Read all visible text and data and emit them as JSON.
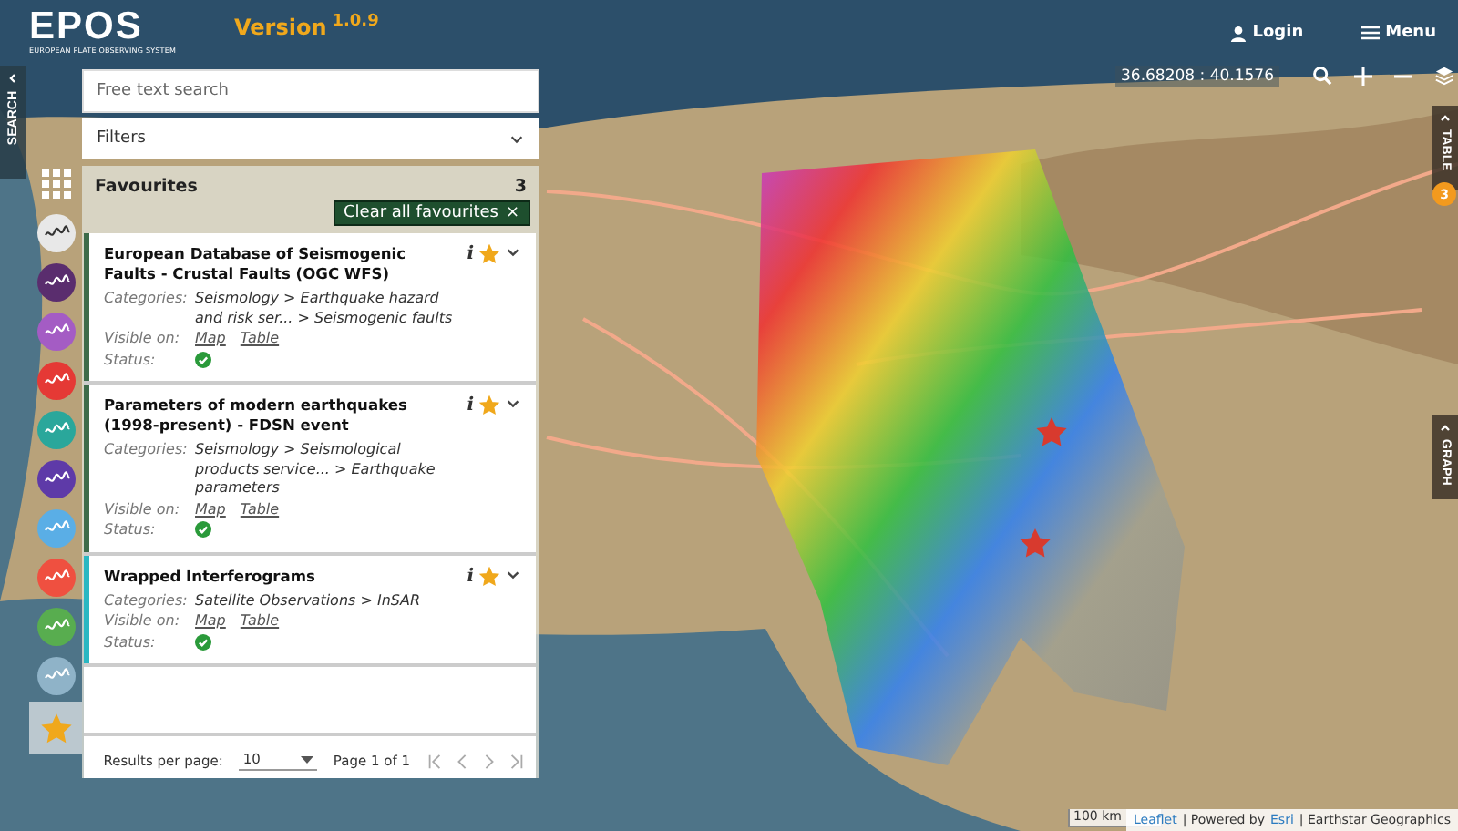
{
  "header": {
    "logo": "EPOS",
    "logo_subtitle": "EUROPEAN PLATE OBSERVING SYSTEM",
    "version_label": "Version",
    "version_number": "1.0.9",
    "login": "Login",
    "menu": "Menu"
  },
  "left_tab": {
    "label": "SEARCH"
  },
  "search": {
    "placeholder": "Free text search"
  },
  "filters": {
    "label": "Filters",
    "expanded": false
  },
  "categories": [
    {
      "kind": "grid",
      "selected": false
    },
    {
      "kind": "circle",
      "color": "#e8e8e8",
      "selected": false
    },
    {
      "kind": "circle",
      "color": "#5a2d6e",
      "selected": false
    },
    {
      "kind": "circle",
      "color": "#a45cc4",
      "selected": false
    },
    {
      "kind": "circle",
      "color": "#e53935",
      "selected": false
    },
    {
      "kind": "circle",
      "color": "#2aa79b",
      "selected": false
    },
    {
      "kind": "circle",
      "color": "#5e3aa8",
      "selected": false
    },
    {
      "kind": "circle",
      "color": "#5aaee6",
      "selected": false
    },
    {
      "kind": "circle",
      "color": "#ef5040",
      "selected": false
    },
    {
      "kind": "circle",
      "color": "#58ad4f",
      "selected": false
    },
    {
      "kind": "circle",
      "color": "#8fb3c8",
      "selected": false
    },
    {
      "kind": "star",
      "selected": true
    }
  ],
  "favourites": {
    "title": "Favourites",
    "count": "3",
    "clear_button": "Clear all favourites",
    "clear_icon": "×"
  },
  "results": [
    {
      "title": "European Database of Seismogenic Faults - Crustal Faults (OGC WFS)",
      "color": "#3d6b4a",
      "categories_label": "Categories:",
      "categories": "Seismology > Earthquake hazard and risk ser... > Seismogenic faults",
      "visible_label": "Visible on:",
      "views": [
        "Map",
        "Table"
      ],
      "status_label": "Status:",
      "status_ok": true,
      "info": "i",
      "favourite": true,
      "expanded": false
    },
    {
      "title": "Parameters of modern earthquakes (1998-present) - FDSN event",
      "color": "#3d6b4a",
      "categories_label": "Categories:",
      "categories": "Seismology > Seismological products service... > Earthquake parameters",
      "visible_label": "Visible on:",
      "views": [
        "Map",
        "Table"
      ],
      "status_label": "Status:",
      "status_ok": true,
      "info": "i",
      "favourite": true,
      "expanded": false
    },
    {
      "title": "Wrapped Interferograms",
      "color": "#2ab7c2",
      "categories_label": "Categories:",
      "categories": "Satellite Observations > InSAR",
      "visible_label": "Visible on:",
      "views": [
        "Map",
        "Table"
      ],
      "status_label": "Status:",
      "status_ok": true,
      "info": "i",
      "favourite": true,
      "expanded": false
    }
  ],
  "pagination": {
    "label": "Results per page:",
    "per_page": "10",
    "page_info": "Page 1 of 1"
  },
  "map": {
    "coordinates": "36.68208 : 40.1576",
    "scale": "100 km",
    "attribution": [
      {
        "kind": "link",
        "text": "Leaflet"
      },
      {
        "kind": "text",
        "text": "| Powered by"
      },
      {
        "kind": "link",
        "text": "Esri"
      },
      {
        "kind": "text",
        "text": "| Earthstar Geographics"
      }
    ]
  },
  "right_tabs": [
    {
      "label": "TABLE",
      "badge": "3"
    },
    {
      "label": "GRAPH"
    }
  ]
}
